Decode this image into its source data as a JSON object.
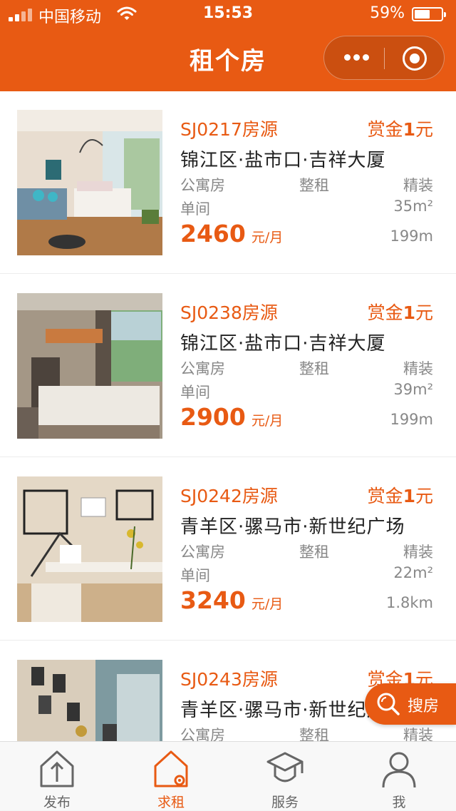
{
  "status_bar": {
    "carrier": "中国移动",
    "time": "15:53",
    "battery": "59%",
    "battery_level": 0.59
  },
  "nav": {
    "title": "租个房",
    "more_icon": "more-dots-icon",
    "close_icon": "target-close-icon"
  },
  "colors": {
    "accent": "#e85a13",
    "text_dark": "#222222",
    "text_muted": "#888888"
  },
  "listings": [
    {
      "code": "SJ0217房源",
      "reward_prefix": "赏金",
      "reward_amount": "1",
      "reward_unit": "元",
      "address": "锦江区·盐市口·吉祥大厦",
      "type": "公寓房",
      "rent_mode": "整租",
      "decoration": "精装",
      "room": "单间",
      "area": "35m²",
      "price": "2460",
      "price_unit": "元/月",
      "distance": "199m"
    },
    {
      "code": "SJ0238房源",
      "reward_prefix": "赏金",
      "reward_amount": "1",
      "reward_unit": "元",
      "address": "锦江区·盐市口·吉祥大厦",
      "type": "公寓房",
      "rent_mode": "整租",
      "decoration": "精装",
      "room": "单间",
      "area": "39m²",
      "price": "2900",
      "price_unit": "元/月",
      "distance": "199m"
    },
    {
      "code": "SJ0242房源",
      "reward_prefix": "赏金",
      "reward_amount": "1",
      "reward_unit": "元",
      "address": "青羊区·骡马市·新世纪广场",
      "type": "公寓房",
      "rent_mode": "整租",
      "decoration": "精装",
      "room": "单间",
      "area": "22m²",
      "price": "3240",
      "price_unit": "元/月",
      "distance": "1.8km"
    },
    {
      "code": "SJ0243房源",
      "reward_prefix": "赏金",
      "reward_amount": "1",
      "reward_unit": "元",
      "address": "青羊区·骡马市·新世纪广场",
      "type": "公寓房",
      "rent_mode": "整租",
      "decoration": "精装"
    }
  ],
  "search_button": {
    "label": "搜房",
    "icon": "search-icon"
  },
  "tabs": [
    {
      "label": "发布",
      "icon": "publish-house-icon",
      "active": false
    },
    {
      "label": "求租",
      "icon": "house-gear-icon",
      "active": true
    },
    {
      "label": "服务",
      "icon": "graduation-cap-icon",
      "active": false
    },
    {
      "label": "我",
      "icon": "user-icon",
      "active": false
    }
  ]
}
